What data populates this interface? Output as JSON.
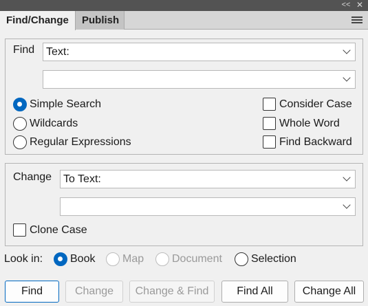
{
  "window": {
    "collapse_glyph": "<<",
    "close_glyph": "✕"
  },
  "tabs": [
    {
      "label": "Find/Change",
      "active": true
    },
    {
      "label": "Publish",
      "active": false
    }
  ],
  "find": {
    "label": "Find",
    "type_value": "Text:",
    "query_value": "",
    "search_modes": [
      {
        "label": "Simple Search",
        "selected": true
      },
      {
        "label": "Wildcards",
        "selected": false
      },
      {
        "label": "Regular Expressions",
        "selected": false
      }
    ],
    "options": [
      {
        "label": "Consider Case",
        "checked": false
      },
      {
        "label": "Whole Word",
        "checked": false
      },
      {
        "label": "Find Backward",
        "checked": false
      }
    ]
  },
  "change": {
    "label": "Change",
    "type_value": "To Text:",
    "replace_value": "",
    "clone_case_label": "Clone Case",
    "clone_case_checked": false
  },
  "look_in": {
    "label": "Look in:",
    "options": [
      {
        "label": "Book",
        "selected": true,
        "enabled": true
      },
      {
        "label": "Map",
        "selected": false,
        "enabled": false
      },
      {
        "label": "Document",
        "selected": false,
        "enabled": false
      },
      {
        "label": "Selection",
        "selected": false,
        "enabled": true
      }
    ]
  },
  "buttons": {
    "find": "Find",
    "change": "Change",
    "change_find": "Change & Find",
    "find_all": "Find All",
    "change_all": "Change All"
  },
  "colors": {
    "accent": "#0067c0",
    "titlebar": "#535353",
    "panel": "#f0f0f0"
  }
}
